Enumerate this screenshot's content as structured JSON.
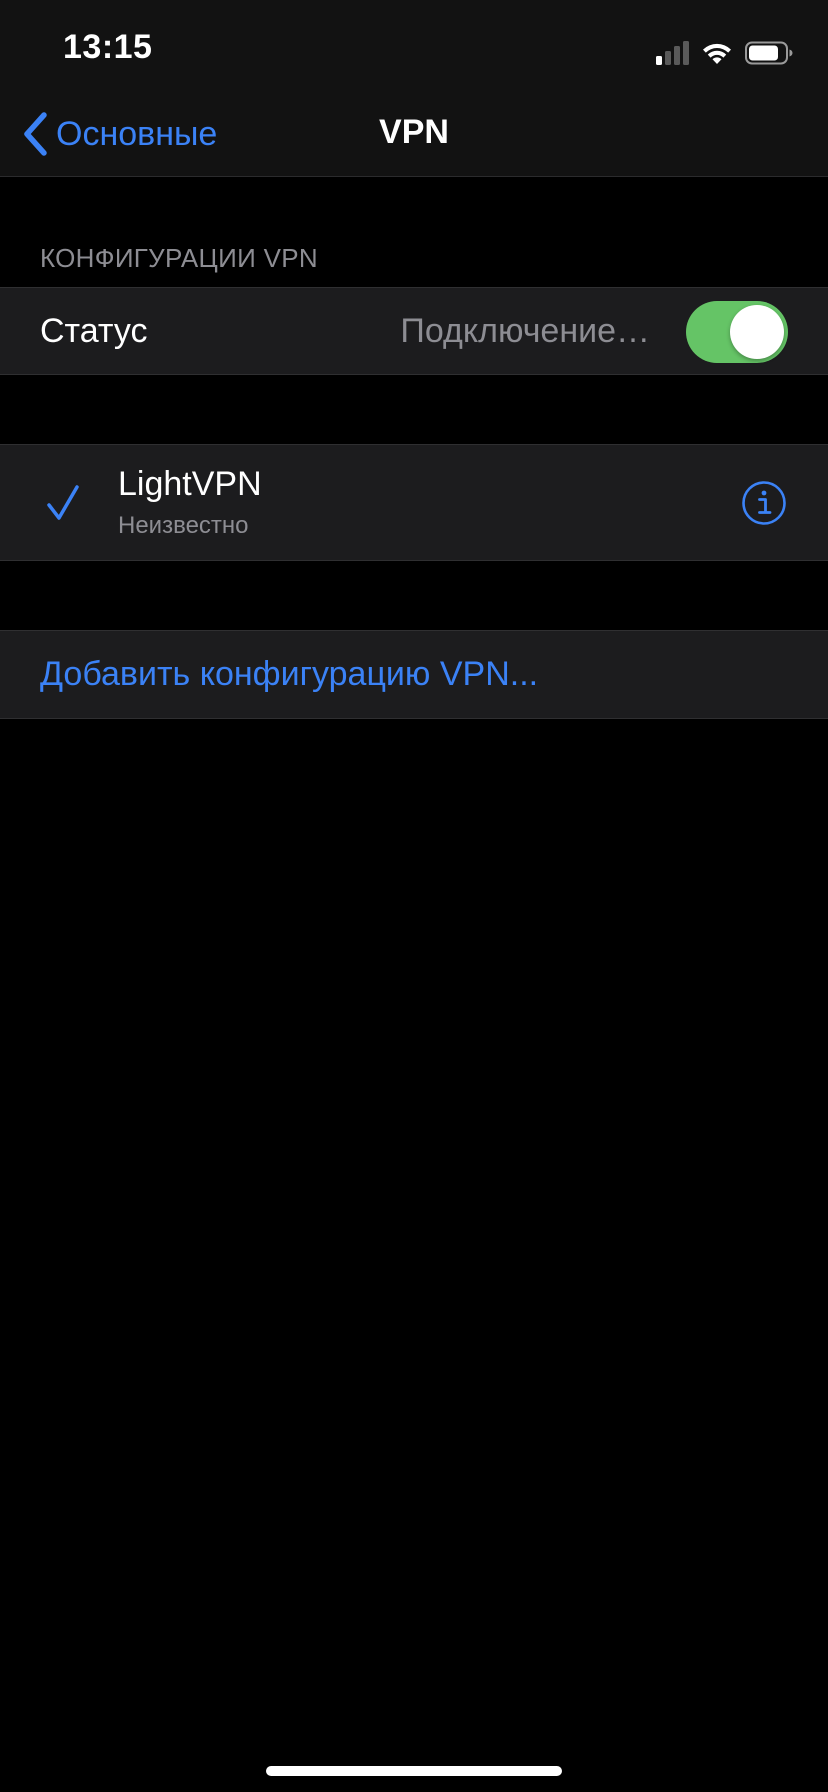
{
  "status_bar": {
    "time": "13:15",
    "signal_bars_active": 1,
    "signal_bars_total": 4,
    "battery_level": 0.8,
    "icons": [
      "signal-icon",
      "wifi-icon",
      "battery-icon"
    ]
  },
  "nav": {
    "back_label": "Основные",
    "title": "VPN"
  },
  "section": {
    "header": "КОНФИГУРАЦИИ VPN"
  },
  "status_row": {
    "label": "Статус",
    "value": "Подключение…",
    "toggle_on": true
  },
  "vpn_config": {
    "name": "LightVPN",
    "status": "Неизвестно",
    "selected": true
  },
  "add_config": {
    "label": "Добавить конфигурацию VPN..."
  },
  "colors": {
    "accent": "#3b82f6",
    "toggle_on": "#65c466",
    "background": "#000000",
    "cell": "#1c1c1e",
    "secondary_text": "#8d8d93"
  }
}
